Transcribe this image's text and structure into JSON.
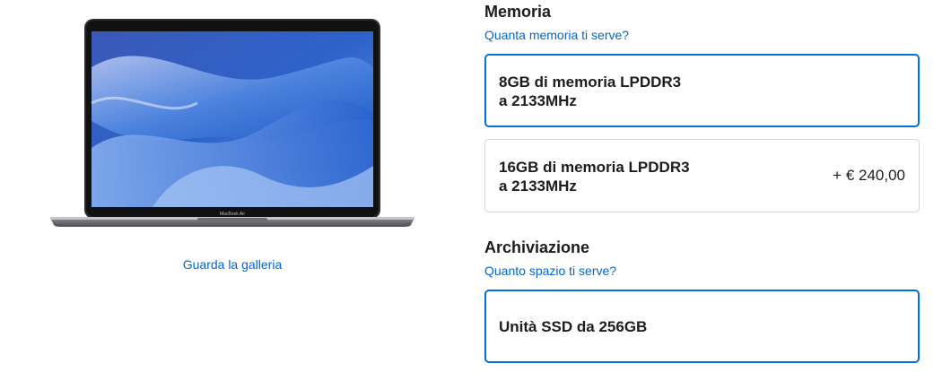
{
  "gallery": {
    "link_label": "Guarda la galleria"
  },
  "product_image": {
    "badge_text": "MacBook Air"
  },
  "memory": {
    "title": "Memoria",
    "help_link": "Quanta memoria ti serve?",
    "options": [
      {
        "line1": "8GB di memoria LPDDR3",
        "line2": "a 2133MHz",
        "price": "",
        "selected": true
      },
      {
        "line1": "16GB di memoria LPDDR3",
        "line2": "a 2133MHz",
        "price": "+ € 240,00",
        "selected": false
      }
    ]
  },
  "storage": {
    "title": "Archiviazione",
    "help_link": "Quanto spazio ti serve?",
    "options": [
      {
        "line1": "Unità SSD da 256GB",
        "selected": true
      }
    ]
  },
  "colors": {
    "accent": "#0071e3",
    "link": "#0066cc",
    "text": "#1d1d1f",
    "border": "#d2d2d7"
  }
}
